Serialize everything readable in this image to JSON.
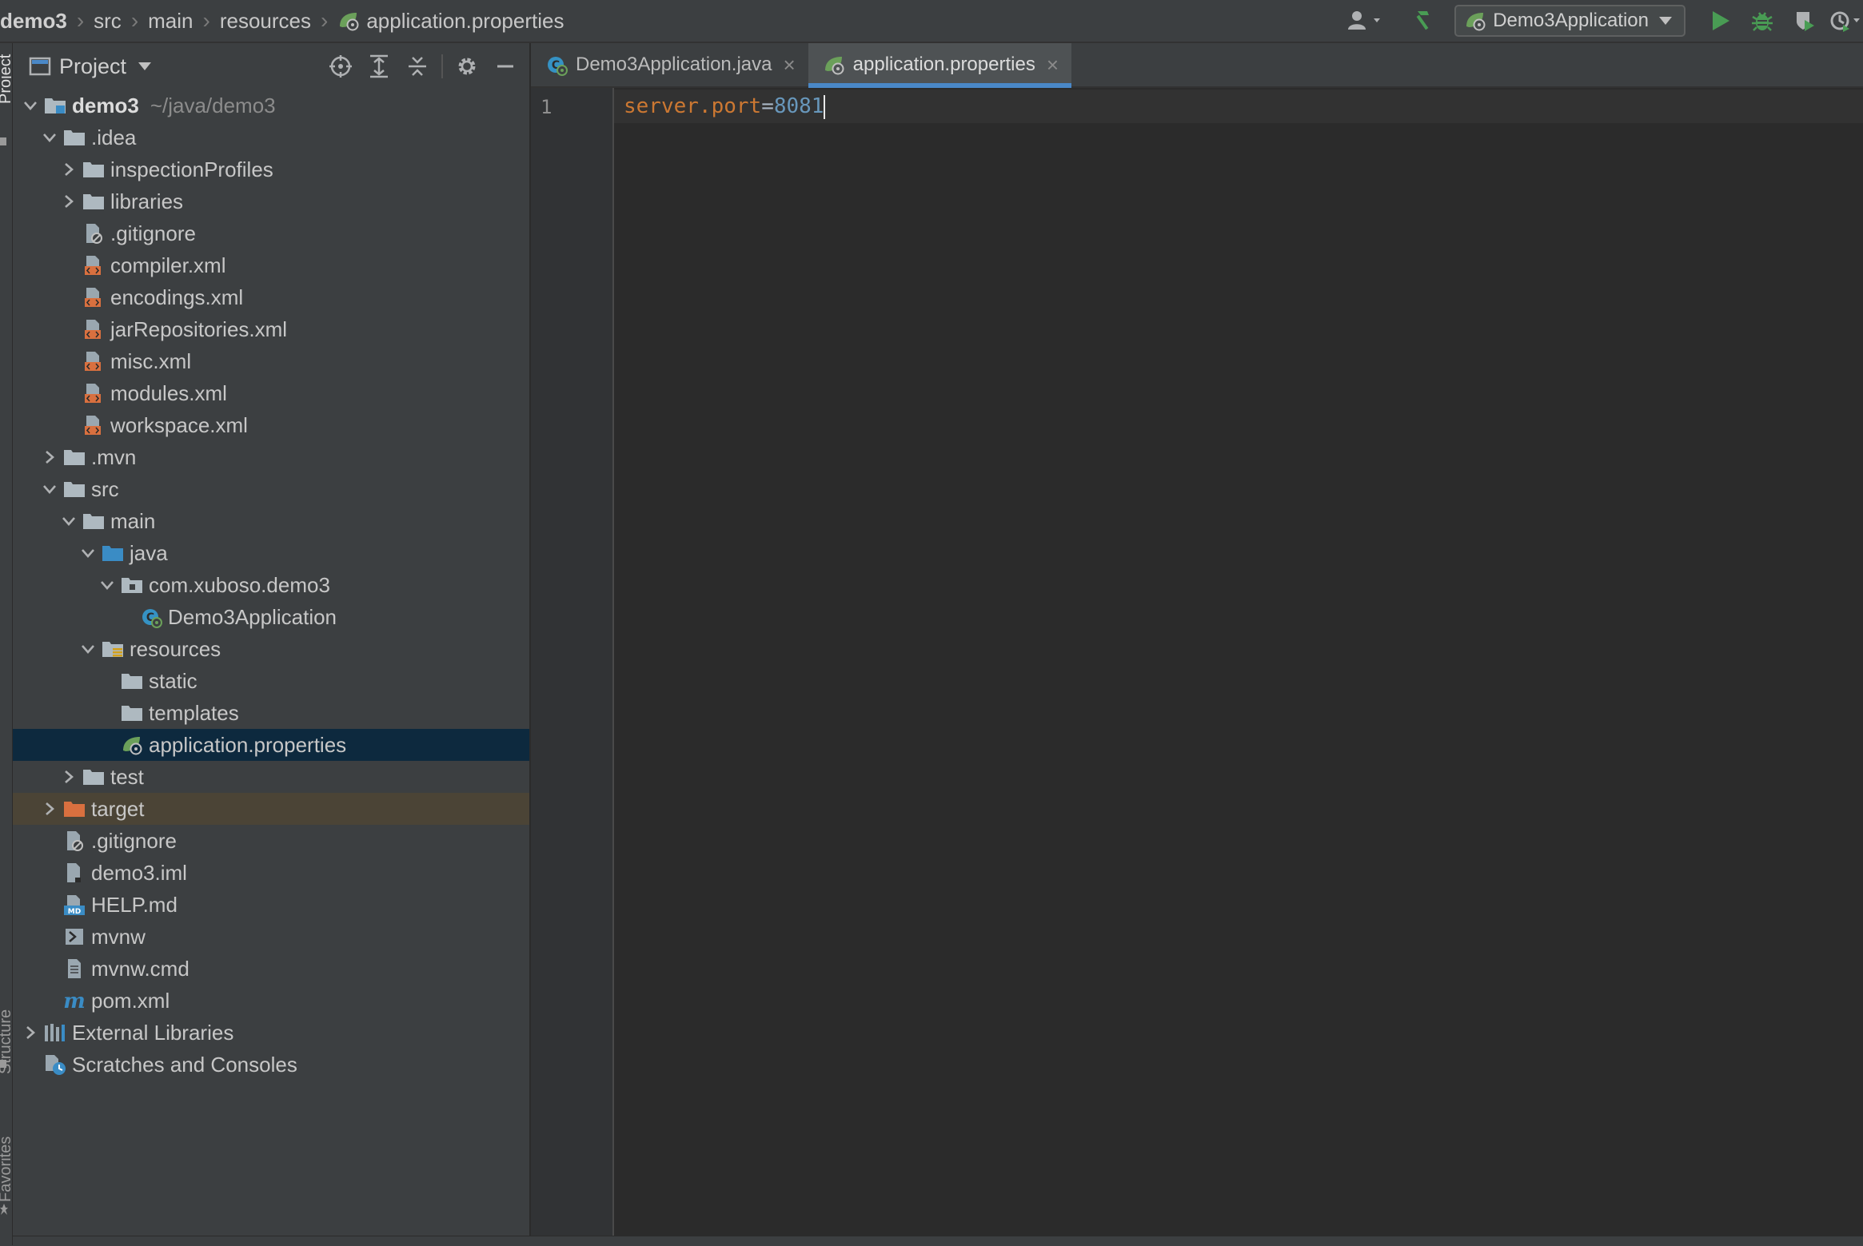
{
  "breadcrumb": [
    "demo3",
    "src",
    "main",
    "resources",
    "application.properties"
  ],
  "run_config": {
    "label": "Demo3Application"
  },
  "left_stripe": {
    "project": "Project",
    "structure": "Structure",
    "favorites": "Favorites"
  },
  "project_panel": {
    "title": "Project"
  },
  "tree": [
    {
      "label": "demo3",
      "hint": "~/java/demo3",
      "depth": 0,
      "arrow": "open",
      "icon": "module-folder-icon",
      "bold": true
    },
    {
      "label": ".idea",
      "depth": 1,
      "arrow": "open",
      "icon": "folder-icon"
    },
    {
      "label": "inspectionProfiles",
      "depth": 2,
      "arrow": "closed",
      "icon": "folder-icon"
    },
    {
      "label": "libraries",
      "depth": 2,
      "arrow": "closed",
      "icon": "folder-icon"
    },
    {
      "label": ".gitignore",
      "depth": 2,
      "arrow": "none",
      "icon": "ignore-file-icon"
    },
    {
      "label": "compiler.xml",
      "depth": 2,
      "arrow": "none",
      "icon": "xml-file-icon"
    },
    {
      "label": "encodings.xml",
      "depth": 2,
      "arrow": "none",
      "icon": "xml-file-icon"
    },
    {
      "label": "jarRepositories.xml",
      "depth": 2,
      "arrow": "none",
      "icon": "xml-file-icon"
    },
    {
      "label": "misc.xml",
      "depth": 2,
      "arrow": "none",
      "icon": "xml-file-icon"
    },
    {
      "label": "modules.xml",
      "depth": 2,
      "arrow": "none",
      "icon": "xml-file-icon"
    },
    {
      "label": "workspace.xml",
      "depth": 2,
      "arrow": "none",
      "icon": "xml-file-icon"
    },
    {
      "label": ".mvn",
      "depth": 1,
      "arrow": "closed",
      "icon": "folder-icon"
    },
    {
      "label": "src",
      "depth": 1,
      "arrow": "open",
      "icon": "folder-icon"
    },
    {
      "label": "main",
      "depth": 2,
      "arrow": "open",
      "icon": "folder-icon"
    },
    {
      "label": "java",
      "depth": 3,
      "arrow": "open",
      "icon": "source-folder-icon"
    },
    {
      "label": "com.xuboso.demo3",
      "depth": 4,
      "arrow": "open",
      "icon": "package-icon"
    },
    {
      "label": "Demo3Application",
      "depth": 5,
      "arrow": "none",
      "icon": "spring-boot-class-icon"
    },
    {
      "label": "resources",
      "depth": 3,
      "arrow": "open",
      "icon": "resources-folder-icon"
    },
    {
      "label": "static",
      "depth": 4,
      "arrow": "none",
      "icon": "folder-icon"
    },
    {
      "label": "templates",
      "depth": 4,
      "arrow": "none",
      "icon": "folder-icon"
    },
    {
      "label": "application.properties",
      "depth": 4,
      "arrow": "none",
      "icon": "spring-properties-icon",
      "selected": true
    },
    {
      "label": "test",
      "depth": 2,
      "arrow": "closed",
      "icon": "folder-icon"
    },
    {
      "label": "target",
      "depth": 1,
      "arrow": "closed",
      "icon": "excluded-folder-icon",
      "excluded": true
    },
    {
      "label": ".gitignore",
      "depth": 1,
      "arrow": "none",
      "icon": "ignore-file-icon"
    },
    {
      "label": "demo3.iml",
      "depth": 1,
      "arrow": "none",
      "icon": "iml-file-icon"
    },
    {
      "label": "HELP.md",
      "depth": 1,
      "arrow": "none",
      "icon": "markdown-file-icon"
    },
    {
      "label": "mvnw",
      "depth": 1,
      "arrow": "none",
      "icon": "shell-script-icon"
    },
    {
      "label": "mvnw.cmd",
      "depth": 1,
      "arrow": "none",
      "icon": "text-file-icon"
    },
    {
      "label": "pom.xml",
      "depth": 1,
      "arrow": "none",
      "icon": "maven-pom-icon"
    },
    {
      "label": "External Libraries",
      "depth": 0,
      "arrow": "closed",
      "icon": "libraries-icon"
    },
    {
      "label": "Scratches and Consoles",
      "depth": 0,
      "arrow": "none",
      "icon": "scratches-icon"
    }
  ],
  "tabs": [
    {
      "label": "Demo3Application.java",
      "icon": "spring-boot-class-icon",
      "active": false
    },
    {
      "label": "application.properties",
      "icon": "spring-properties-icon",
      "active": true
    }
  ],
  "editor": {
    "line_number": "1",
    "key": "server.port",
    "eq": "=",
    "value": "8081"
  },
  "colors": {
    "accent": "#4a88c7",
    "selection": "#0d293e",
    "excluded_row": "#4b4436",
    "property_key": "#cc7832",
    "property_value": "#6897bb",
    "run_green": "#499c54"
  }
}
